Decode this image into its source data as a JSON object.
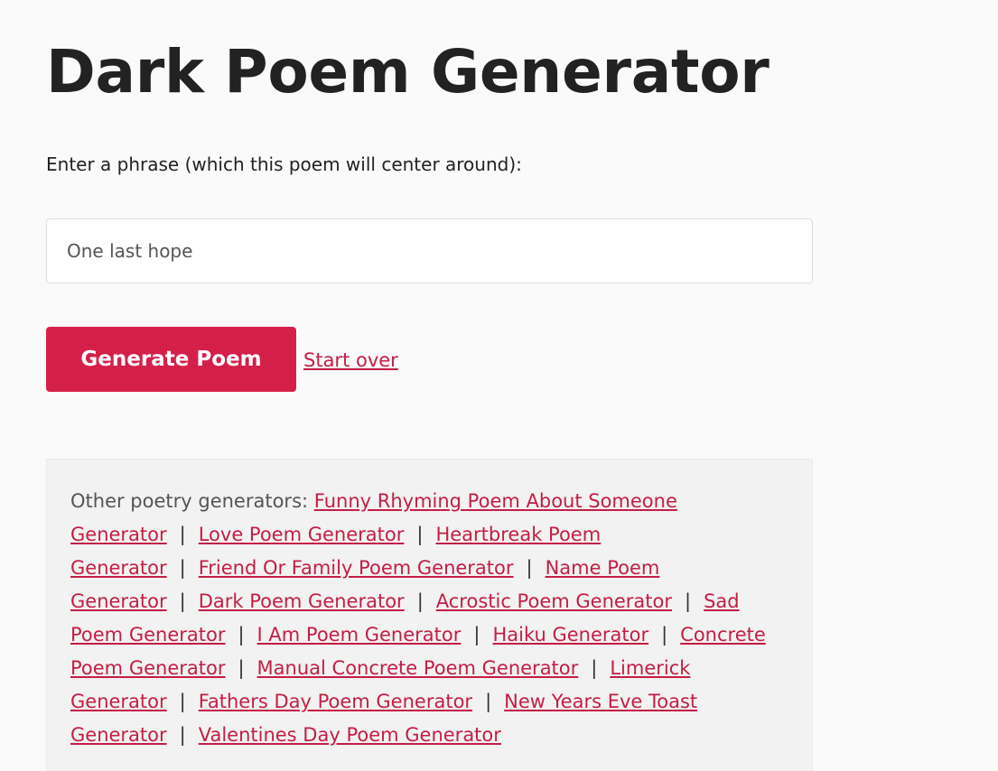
{
  "page": {
    "title": "Dark Poem Generator",
    "prompt_label": "Enter a phrase (which this poem will center around):",
    "phrase_input_value": "One last hope",
    "generate_button_label": "Generate Poem",
    "start_over_label": "Start over"
  },
  "generators": {
    "intro": "Other poetry generators:",
    "separator": "|",
    "links": [
      "Funny Rhyming Poem About Someone Generator",
      "Love Poem Generator",
      "Heartbreak Poem Generator",
      "Friend Or Family Poem Generator",
      "Name Poem Generator",
      "Dark Poem Generator",
      "Acrostic Poem Generator",
      "Sad Poem Generator",
      "I Am Poem Generator",
      "Haiku Generator",
      "Concrete Poem Generator",
      "Manual Concrete Poem Generator",
      "Limerick Generator",
      "Fathers Day Poem Generator",
      "New Years Eve Toast Generator",
      "Valentines Day Poem Generator"
    ]
  },
  "colors": {
    "accent": "#d42049",
    "link": "#c41e45",
    "background": "#fafafa",
    "panel": "#f2f2f2"
  }
}
